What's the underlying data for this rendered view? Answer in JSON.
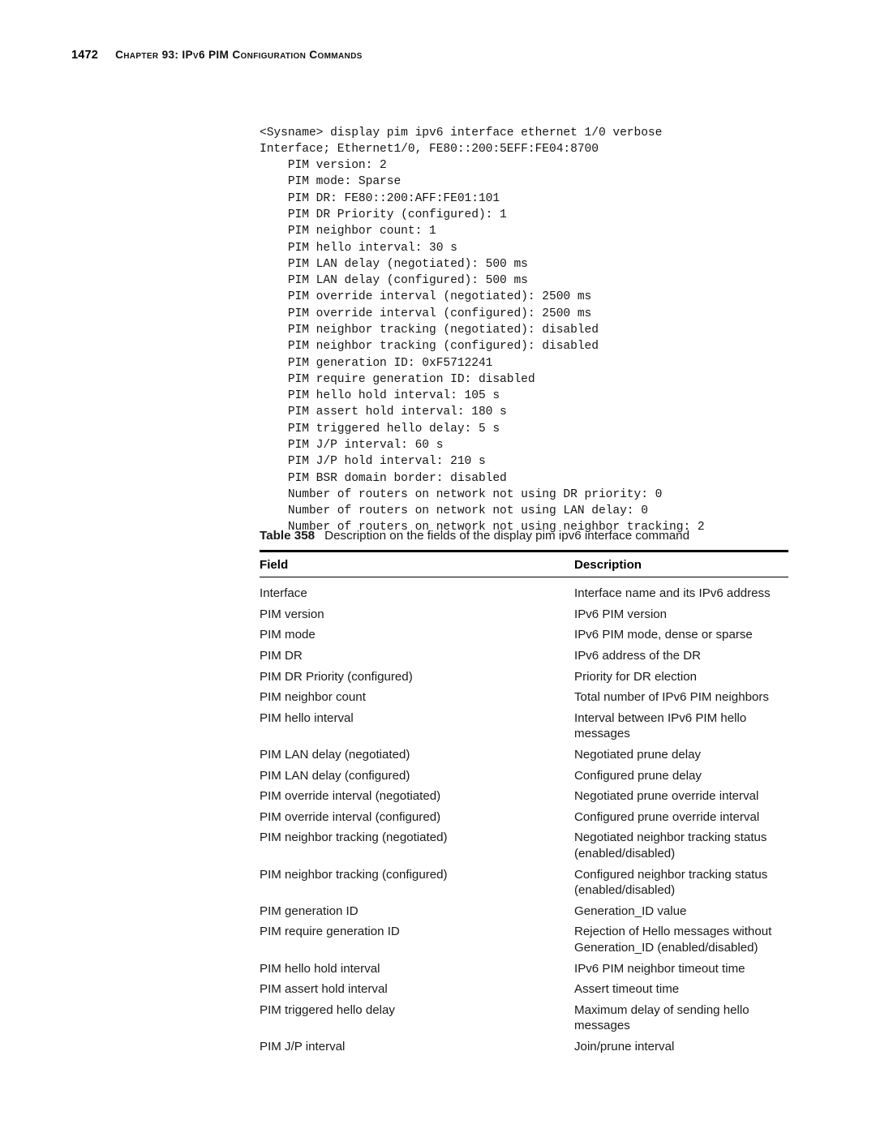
{
  "header": {
    "folio": "1472",
    "title": "Chapter 93: IPv6 PIM Configuration Commands"
  },
  "code_block": {
    "lines": [
      "<Sysname> display pim ipv6 interface ethernet 1/0 verbose",
      "Interface; Ethernet1/0, FE80::200:5EFF:FE04:8700",
      "    PIM version: 2",
      "    PIM mode: Sparse",
      "    PIM DR: FE80::200:AFF:FE01:101",
      "    PIM DR Priority (configured): 1",
      "    PIM neighbor count: 1",
      "    PIM hello interval: 30 s",
      "    PIM LAN delay (negotiated): 500 ms",
      "    PIM LAN delay (configured): 500 ms",
      "    PIM override interval (negotiated): 2500 ms",
      "    PIM override interval (configured): 2500 ms",
      "    PIM neighbor tracking (negotiated): disabled",
      "    PIM neighbor tracking (configured): disabled",
      "    PIM generation ID: 0xF5712241",
      "    PIM require generation ID: disabled",
      "    PIM hello hold interval: 105 s",
      "    PIM assert hold interval: 180 s",
      "    PIM triggered hello delay: 5 s",
      "    PIM J/P interval: 60 s",
      "    PIM J/P hold interval: 210 s",
      "    PIM BSR domain border: disabled",
      "    Number of routers on network not using DR priority: 0",
      "    Number of routers on network not using LAN delay: 0",
      "    Number of routers on network not using neighbor tracking: 2"
    ]
  },
  "table": {
    "number": "Table 358",
    "caption": "Description on the fields of the display pim ipv6 interface command",
    "columns": [
      "Field",
      "Description"
    ],
    "rows": [
      {
        "field": "Interface",
        "description": [
          "Interface name and its IPv6 address"
        ]
      },
      {
        "field": "PIM version",
        "description": [
          "IPv6 PIM version"
        ]
      },
      {
        "field": "PIM mode",
        "description": [
          "IPv6 PIM mode, dense or sparse"
        ]
      },
      {
        "field": "PIM DR",
        "description": [
          "IPv6 address of the DR"
        ]
      },
      {
        "field": "PIM DR Priority (configured)",
        "description": [
          "Priority for DR election"
        ]
      },
      {
        "field": "PIM neighbor count",
        "description": [
          "Total number of IPv6 PIM neighbors"
        ]
      },
      {
        "field": "PIM hello interval",
        "description": [
          "Interval between IPv6 PIM hello",
          "messages"
        ]
      },
      {
        "field": "PIM LAN delay (negotiated)",
        "description": [
          "Negotiated prune delay"
        ]
      },
      {
        "field": "PIM LAN delay (configured)",
        "description": [
          "Configured prune delay"
        ]
      },
      {
        "field": "PIM override interval (negotiated)",
        "description": [
          "Negotiated prune override interval"
        ]
      },
      {
        "field": "PIM override interval (configured)",
        "description": [
          "Configured prune override interval"
        ]
      },
      {
        "field": "PIM neighbor tracking (negotiated)",
        "description": [
          "Negotiated neighbor tracking status",
          "(enabled/disabled)"
        ]
      },
      {
        "field": "PIM neighbor tracking (configured)",
        "description": [
          "Configured neighbor tracking status",
          "(enabled/disabled)"
        ]
      },
      {
        "field": "PIM generation ID",
        "description": [
          "Generation_ID value"
        ]
      },
      {
        "field": "PIM require generation ID",
        "description": [
          "Rejection of Hello messages without",
          "Generation_ID (enabled/disabled)"
        ]
      },
      {
        "field": "PIM hello hold interval",
        "description": [
          "IPv6 PIM neighbor timeout time"
        ]
      },
      {
        "field": "PIM assert hold interval",
        "description": [
          "Assert timeout time"
        ]
      },
      {
        "field": "PIM triggered hello delay",
        "description": [
          "Maximum delay of sending hello",
          "messages"
        ]
      },
      {
        "field": "PIM J/P interval",
        "description": [
          "Join/prune interval"
        ]
      }
    ]
  }
}
